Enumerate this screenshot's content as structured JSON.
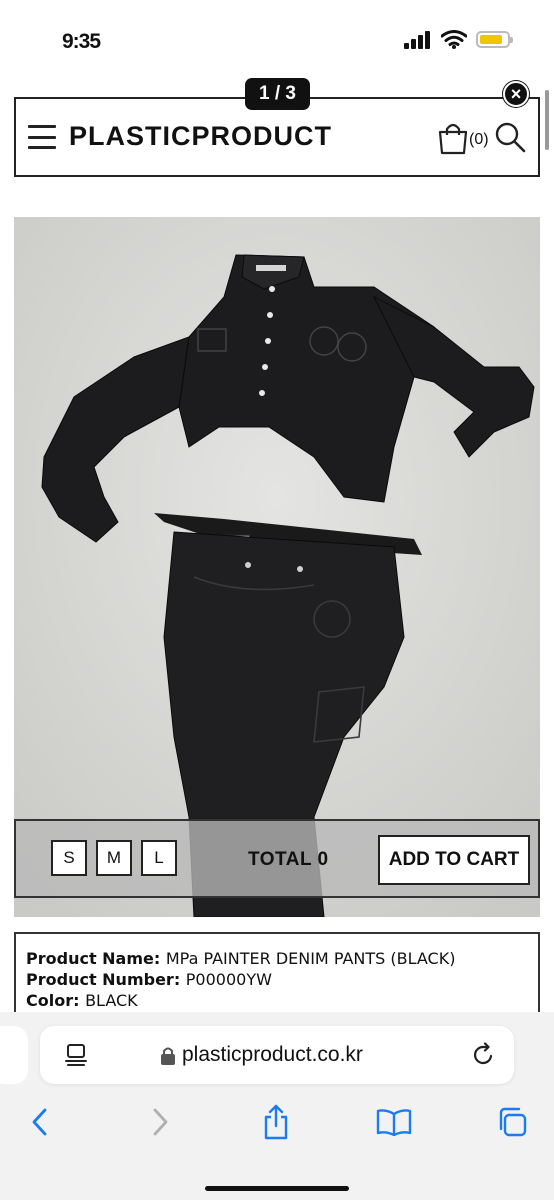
{
  "status_bar": {
    "time": "9:35",
    "battery_level": 0.85,
    "battery_color": "#f5c400"
  },
  "viewer": {
    "page_counter": "1 / 3",
    "close_label": "×"
  },
  "header": {
    "logo": "PLASTICPRODUCT",
    "cart_count": "(0)"
  },
  "product": {
    "sizes": [
      "S",
      "M",
      "L"
    ],
    "total_label": "TOTAL",
    "total_value": "0",
    "add_to_cart": "ADD TO CART",
    "info": {
      "name_label": "Product Name",
      "name_value": "MPa PAINTER DENIM PANTS (BLACK)",
      "number_label": "Product Number",
      "number_value": "P00000YW",
      "color_label": "Color",
      "color_value": "BLACK"
    }
  },
  "browser": {
    "url": "plasticproduct.co.kr",
    "accent_color": "#1a7cf0"
  }
}
